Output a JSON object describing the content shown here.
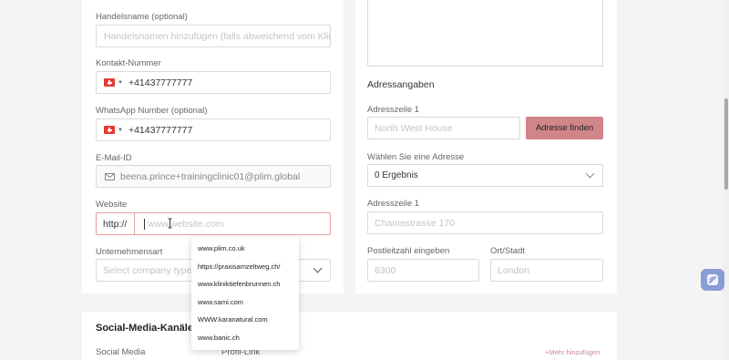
{
  "left": {
    "trade_name_label": "Handelsname (optional)",
    "trade_name_placeholder": "Handelsnamen hinzufügen (falls abweichend vom Klini",
    "contact_label": "Kontakt-Nummer",
    "contact_value": "+41437777777",
    "whatsapp_label": "WhatsApp Number (optional)",
    "whatsapp_value": "+41437777777",
    "email_label": "E-Mail-ID",
    "email_value": "beena.prince+trainingclinic01@plim.global",
    "website_label": "Website",
    "website_prefix": "http://",
    "website_placeholder": "www.website.com",
    "company_type_label": "Unternehmensart",
    "company_type_placeholder": "Select company type"
  },
  "right": {
    "address_section_title": "Adressangaben",
    "address1_label": "Adresszeile 1",
    "address1_placeholder": "North West House",
    "find_address_button": "Adresse finden",
    "choose_address_label": "Wählen Sie eine Adresse",
    "choose_address_value": "0 Ergebnis",
    "address1b_label": "Adresszeile 1",
    "address1b_placeholder": "Chamestrasse 170",
    "postcode_label": "Postleitzahl eingeben",
    "postcode_placeholder": "6300",
    "city_label": "Ort/Stadt",
    "city_placeholder": "London"
  },
  "autocomplete": [
    "www.plim.co.uk",
    "https://praxisamzeltweg.ch/",
    "www.kliniktiefenbrunnen.ch",
    "www.sami.com",
    "WWW.karanatural.com",
    "www.banic.ch"
  ],
  "social": {
    "title": "Social-Media-Kanäle hi",
    "col_social_media": "Social Media",
    "col_profile_link": "Profil-Link",
    "add_more": "+Mehr hinzufügen"
  },
  "colors": {
    "accent": "#d08589",
    "error_border": "#e8a0a0",
    "float_button": "#8c9cd6"
  }
}
